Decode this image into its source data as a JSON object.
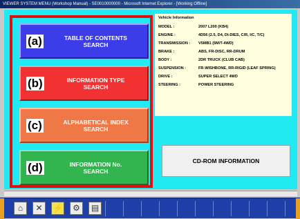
{
  "window": {
    "title": "VIEWER SYSTEM MENU (Workshop Manual) - SE0010000000 - Microsoft Internet Explorer - [Working Offline]"
  },
  "menu": {
    "buttons": [
      {
        "letter": "(a)",
        "label": "TABLE OF CONTENTS\nSEARCH",
        "color": "#3c3ce8"
      },
      {
        "letter": "(b)",
        "label": "INFORMATION TYPE\nSEARCH",
        "color": "#f23232"
      },
      {
        "letter": "(c)",
        "label": "ALPHABETICAL INDEX\nSEARCH",
        "color": "#f07846"
      },
      {
        "letter": "(d)",
        "label": "INFORMATION No.\nSEARCH",
        "color": "#32b44e"
      }
    ]
  },
  "vehicle_info": {
    "title": "Vehicle Information",
    "rows": [
      {
        "key": "MODEL :",
        "value": "2007   L200 (KB4)"
      },
      {
        "key": "ENGINE :",
        "value": "4D56 (2.5, D4, DI-DIES, C/R, I/C, T/C)"
      },
      {
        "key": "TRANSMISSION :",
        "value": "V5MB1 (5M/T-4WD)"
      },
      {
        "key": "BRAKE :",
        "value": "ABS, FR-DISC, RR-DRUM"
      },
      {
        "key": "BODY :",
        "value": "2DR TRUCK (CLUB CAB)"
      },
      {
        "key": "SUSPENSION :",
        "value": "FR-WISHBONE, RR-RIGID (LEAF SPRING)"
      },
      {
        "key": "DRIVE :",
        "value": "SUPER SELECT 4WD"
      },
      {
        "key": "STEERING :",
        "value": "POWER STEERING"
      }
    ]
  },
  "cdrom": {
    "label": "CD-ROM INFORMATION"
  },
  "toolbar": {
    "icons": [
      "home-icon",
      "tools-icon",
      "lightning-icon",
      "gear-icon",
      "book-icon"
    ],
    "glyphs": [
      "⌂",
      "✕",
      "⚡",
      "⚙",
      "▤"
    ]
  },
  "colors": {
    "background": "#22eaf2",
    "highlight_frame": "#e01010"
  }
}
